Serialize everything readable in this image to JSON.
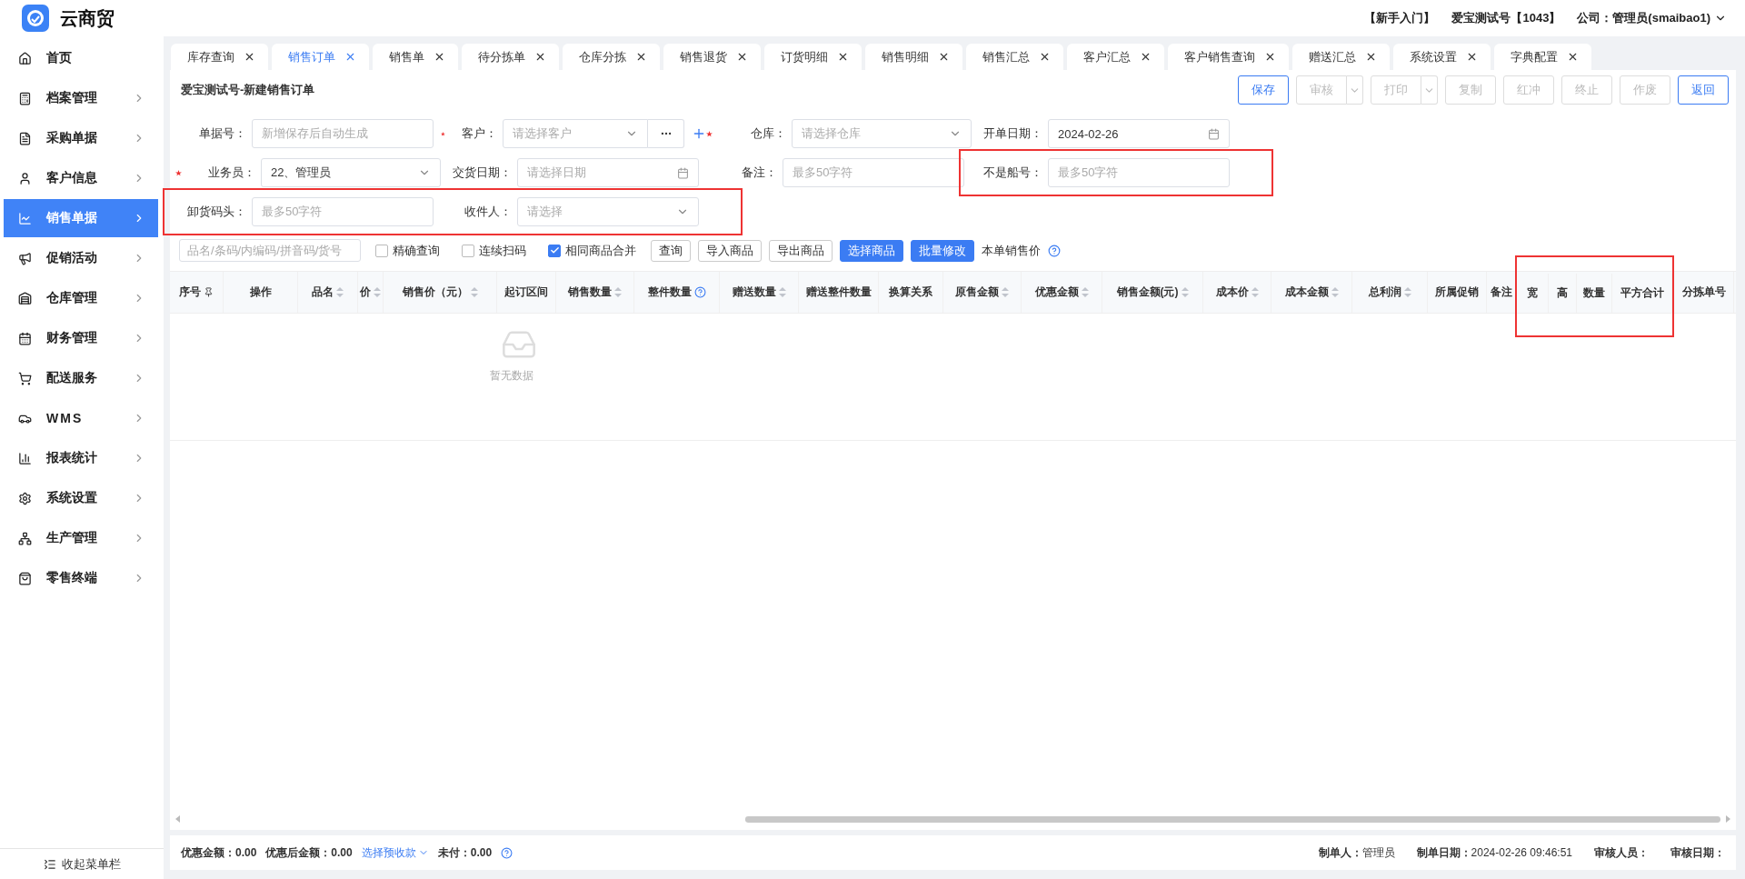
{
  "app": {
    "name": "云商贸"
  },
  "header": {
    "links": [
      "【新手入门】",
      "爱宝测试号【1043】"
    ],
    "account": "公司：管理员(smaibao1)"
  },
  "sidebar": {
    "items": [
      {
        "label": "首页",
        "selected": false,
        "expandable": false
      },
      {
        "label": "档案管理",
        "selected": false,
        "expandable": true
      },
      {
        "label": "采购单据",
        "selected": false,
        "expandable": true
      },
      {
        "label": "客户信息",
        "selected": false,
        "expandable": true
      },
      {
        "label": "销售单据",
        "selected": true,
        "expandable": true
      },
      {
        "label": "促销活动",
        "selected": false,
        "expandable": true
      },
      {
        "label": "仓库管理",
        "selected": false,
        "expandable": true
      },
      {
        "label": "财务管理",
        "selected": false,
        "expandable": true
      },
      {
        "label": "配送服务",
        "selected": false,
        "expandable": true
      },
      {
        "label": "WMS",
        "selected": false,
        "expandable": true
      },
      {
        "label": "报表统计",
        "selected": false,
        "expandable": true
      },
      {
        "label": "系统设置",
        "selected": false,
        "expandable": true
      },
      {
        "label": "生产管理",
        "selected": false,
        "expandable": true
      },
      {
        "label": "零售终端",
        "selected": false,
        "expandable": true
      }
    ],
    "collapse": "收起菜单栏"
  },
  "tabs": [
    {
      "label": "库存查询",
      "selected": false
    },
    {
      "label": "销售订单",
      "selected": true
    },
    {
      "label": "销售单",
      "selected": false
    },
    {
      "label": "待分拣单",
      "selected": false
    },
    {
      "label": "仓库分拣",
      "selected": false
    },
    {
      "label": "销售退货",
      "selected": false
    },
    {
      "label": "订货明细",
      "selected": false
    },
    {
      "label": "销售明细",
      "selected": false
    },
    {
      "label": "销售汇总",
      "selected": false
    },
    {
      "label": "客户汇总",
      "selected": false
    },
    {
      "label": "客户销售查询",
      "selected": false
    },
    {
      "label": "赠送汇总",
      "selected": false
    },
    {
      "label": "系统设置",
      "selected": false
    },
    {
      "label": "字典配置",
      "selected": false
    }
  ],
  "page_title": "爱宝测试号-新建销售订单",
  "actions": [
    {
      "label": "保存",
      "disabled": false,
      "dropdown": false
    },
    {
      "label": "审核",
      "disabled": true,
      "dropdown": true
    },
    {
      "label": "打印",
      "disabled": true,
      "dropdown": true
    },
    {
      "label": "复制",
      "disabled": true,
      "dropdown": false
    },
    {
      "label": "红冲",
      "disabled": true,
      "dropdown": false
    },
    {
      "label": "终止",
      "disabled": true,
      "dropdown": false
    },
    {
      "label": "作废",
      "disabled": true,
      "dropdown": false
    },
    {
      "label": "返回",
      "disabled": false,
      "dropdown": false
    }
  ],
  "form": {
    "rows": [
      {
        "fields": [
          {
            "label": "单据号：",
            "required": false,
            "kind": "text",
            "placeholder": "新增保存后自动生成",
            "highlighted": false
          },
          {
            "label": "客户：",
            "required": true,
            "kind": "customer",
            "placeholder": "请选择客户",
            "highlighted": false
          },
          {
            "label": "仓库：",
            "required": true,
            "kind": "select",
            "placeholder": "请选择仓库",
            "highlighted": false
          },
          {
            "label": "开单日期：",
            "required": false,
            "kind": "date",
            "value": "2024-02-26",
            "highlighted": false
          }
        ]
      },
      {
        "fields": [
          {
            "label": "业务员：",
            "required": true,
            "kind": "select",
            "value": "22、管理员",
            "highlighted": false
          },
          {
            "label": "交货日期：",
            "required": false,
            "kind": "date",
            "placeholder": "请选择日期",
            "highlighted": false
          },
          {
            "label": "备注：",
            "required": false,
            "kind": "text",
            "placeholder": "最多50字符",
            "highlighted": false
          },
          {
            "label": "不是船号：",
            "required": false,
            "kind": "text",
            "placeholder": "最多50字符",
            "highlighted": true
          }
        ]
      },
      {
        "fields": [
          {
            "label": "卸货码头：",
            "required": false,
            "kind": "text",
            "placeholder": "最多50字符",
            "highlighted": true
          },
          {
            "label": "收件人：",
            "required": false,
            "kind": "select",
            "placeholder": "请选择",
            "highlighted": true
          }
        ]
      }
    ]
  },
  "toolbar": {
    "search": {
      "placeholder": "品名/条码/内编码/拼音码/货号"
    },
    "checks": [
      {
        "label": "精确查询",
        "checked": false
      },
      {
        "label": "连续扫码",
        "checked": false
      },
      {
        "label": "相同商品合并",
        "checked": true
      }
    ],
    "buttons": [
      {
        "label": "查询",
        "primary": false
      },
      {
        "label": "导入商品",
        "primary": false
      },
      {
        "label": "导出商品",
        "primary": false
      },
      {
        "label": "选择商品",
        "primary": true
      },
      {
        "label": "批量修改",
        "primary": true
      }
    ],
    "note": "本单销售价"
  },
  "table": {
    "columns": [
      {
        "label": "序号",
        "kind": "pin",
        "highlighted": false
      },
      {
        "label": "操作",
        "kind": "plain",
        "highlighted": false
      },
      {
        "label": "品名",
        "kind": "sortable",
        "highlighted": false
      },
      {
        "label": "价",
        "kind": "sortable",
        "highlighted": false
      },
      {
        "label": "销售价（元）",
        "kind": "sortable",
        "highlighted": false
      },
      {
        "label": "起订区间",
        "kind": "plain",
        "highlighted": false
      },
      {
        "label": "销售数量",
        "kind": "sortable",
        "highlighted": false
      },
      {
        "label": "整件数量",
        "kind": "help",
        "highlighted": false
      },
      {
        "label": "赠送数量",
        "kind": "sortable",
        "highlighted": false
      },
      {
        "label": "赠送整件数量",
        "kind": "plain",
        "highlighted": false
      },
      {
        "label": "换算关系",
        "kind": "plain",
        "highlighted": false
      },
      {
        "label": "原售金额",
        "kind": "sortable",
        "highlighted": false
      },
      {
        "label": "优惠金额",
        "kind": "sortable",
        "highlighted": false
      },
      {
        "label": "销售金额(元)",
        "kind": "sortable",
        "highlighted": false
      },
      {
        "label": "成本价",
        "kind": "sortable",
        "highlighted": false
      },
      {
        "label": "成本金额",
        "kind": "sortable",
        "highlighted": false
      },
      {
        "label": "总利润",
        "kind": "sortable",
        "highlighted": false
      },
      {
        "label": "所属促销",
        "kind": "plain",
        "highlighted": false
      },
      {
        "label": "备注",
        "kind": "plain",
        "highlighted": false
      },
      {
        "label": "宽",
        "kind": "plain",
        "highlighted": true
      },
      {
        "label": "高",
        "kind": "plain",
        "highlighted": true
      },
      {
        "label": "数量",
        "kind": "plain",
        "highlighted": true
      },
      {
        "label": "平方合计",
        "kind": "plain",
        "highlighted": true
      },
      {
        "label": "分拣单号",
        "kind": "plain",
        "highlighted": false
      }
    ],
    "empty_text": "暂无数据"
  },
  "footer": {
    "left": [
      {
        "kind": "stat",
        "label": "优惠金额：",
        "value": "0.00"
      },
      {
        "kind": "stat",
        "label": "优惠后金额：",
        "value": "0.00"
      },
      {
        "kind": "link",
        "label": "选择预收款"
      },
      {
        "kind": "help",
        "label": "未付：",
        "value": "0.00"
      }
    ],
    "right": [
      {
        "label": "制单人：",
        "value": "管理员"
      },
      {
        "label": "制单日期：",
        "value": "2024-02-26 09:46:51"
      },
      {
        "label": "审核人员："
      },
      {
        "label": "审核日期："
      }
    ]
  }
}
